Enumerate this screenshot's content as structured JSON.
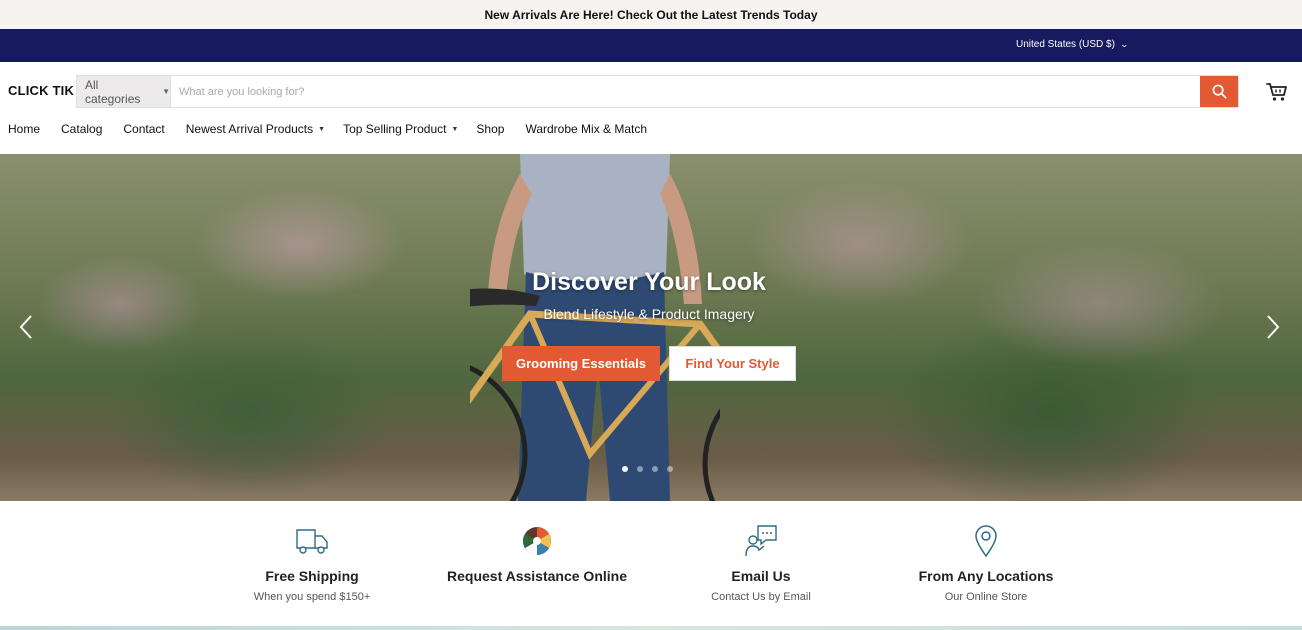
{
  "announcement": {
    "text": "New Arrivals Are Here! Check Out the Latest Trends Today"
  },
  "utility_bar": {
    "currency": "United States (USD $)"
  },
  "header": {
    "logo": "CLICK TIK",
    "search": {
      "category": "All categories",
      "placeholder": "What are you looking for?",
      "value": ""
    },
    "cart_icon": "cart-icon",
    "search_icon": "search-icon"
  },
  "nav": {
    "items": [
      {
        "label": "Home",
        "has_dropdown": false
      },
      {
        "label": "Catalog",
        "has_dropdown": false
      },
      {
        "label": "Contact",
        "has_dropdown": false
      },
      {
        "label": "Newest Arrival Products",
        "has_dropdown": true
      },
      {
        "label": "Top Selling Product",
        "has_dropdown": true
      },
      {
        "label": "Shop",
        "has_dropdown": false
      },
      {
        "label": "Wardrobe Mix & Match",
        "has_dropdown": false
      }
    ]
  },
  "hero": {
    "title": "Discover Your Look",
    "subtitle": "Blend Lifestyle & Product Imagery",
    "primary_button": "Grooming Essentials",
    "secondary_button": "Find Your Style",
    "slide_count": 4,
    "active_slide": 1
  },
  "features": [
    {
      "icon": "truck-icon",
      "title": "Free Shipping",
      "subtitle": "When you spend $150+"
    },
    {
      "icon": "assistance-icon",
      "title": "Request Assistance Online",
      "subtitle": ""
    },
    {
      "icon": "email-chat-icon",
      "title": "Email Us",
      "subtitle": "Contact Us by Email"
    },
    {
      "icon": "location-pin-icon",
      "title": "From Any Locations",
      "subtitle": "Our Online Store"
    }
  ],
  "colors": {
    "accent": "#e25a33",
    "utility_bar": "#171a5e",
    "announcement_bg": "#f5f4f0",
    "icon_teal": "#2f6b86"
  }
}
